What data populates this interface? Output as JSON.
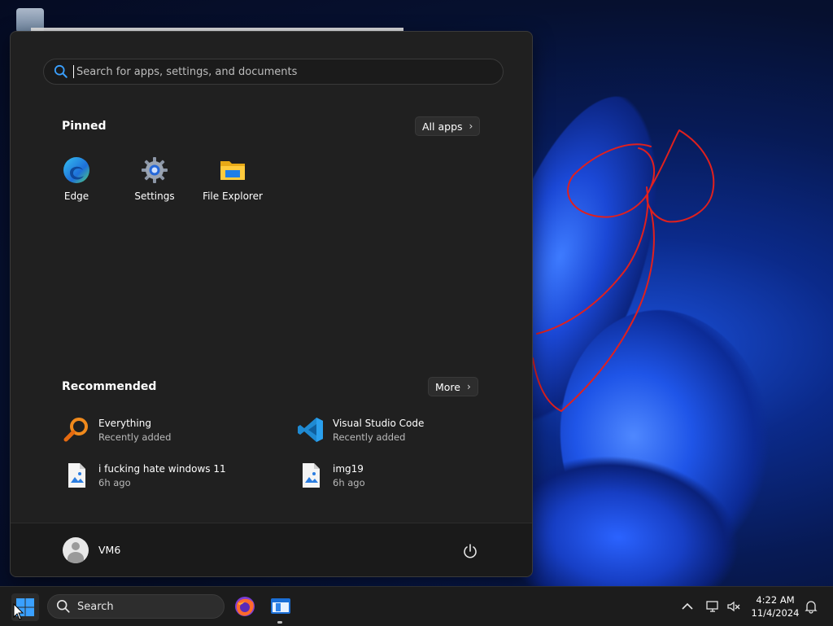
{
  "search": {
    "placeholder": "Search for apps, settings, and documents"
  },
  "pinned": {
    "title": "Pinned",
    "all_apps_label": "All apps",
    "apps": [
      {
        "label": "Edge",
        "icon": "edge-icon"
      },
      {
        "label": "Settings",
        "icon": "settings-gear-icon"
      },
      {
        "label": "File Explorer",
        "icon": "folder-icon"
      }
    ]
  },
  "recommended": {
    "title": "Recommended",
    "more_label": "More",
    "items": [
      {
        "name": "Everything",
        "subtitle": "Recently added",
        "icon": "everything-search-icon"
      },
      {
        "name": "Visual Studio Code",
        "subtitle": "Recently added",
        "icon": "vscode-icon"
      },
      {
        "name": "i fucking hate windows 11",
        "subtitle": "6h ago",
        "icon": "image-file-icon"
      },
      {
        "name": "img19",
        "subtitle": "6h ago",
        "icon": "image-file-icon"
      }
    ]
  },
  "user": {
    "name": "VM6"
  },
  "taskbar": {
    "search_label": "Search",
    "clock": {
      "time": "4:22 AM",
      "date": "11/4/2024"
    }
  },
  "colors": {
    "accent": "#3aa0ff",
    "menu_bg": "#202020",
    "scribble": "#e0201e"
  }
}
